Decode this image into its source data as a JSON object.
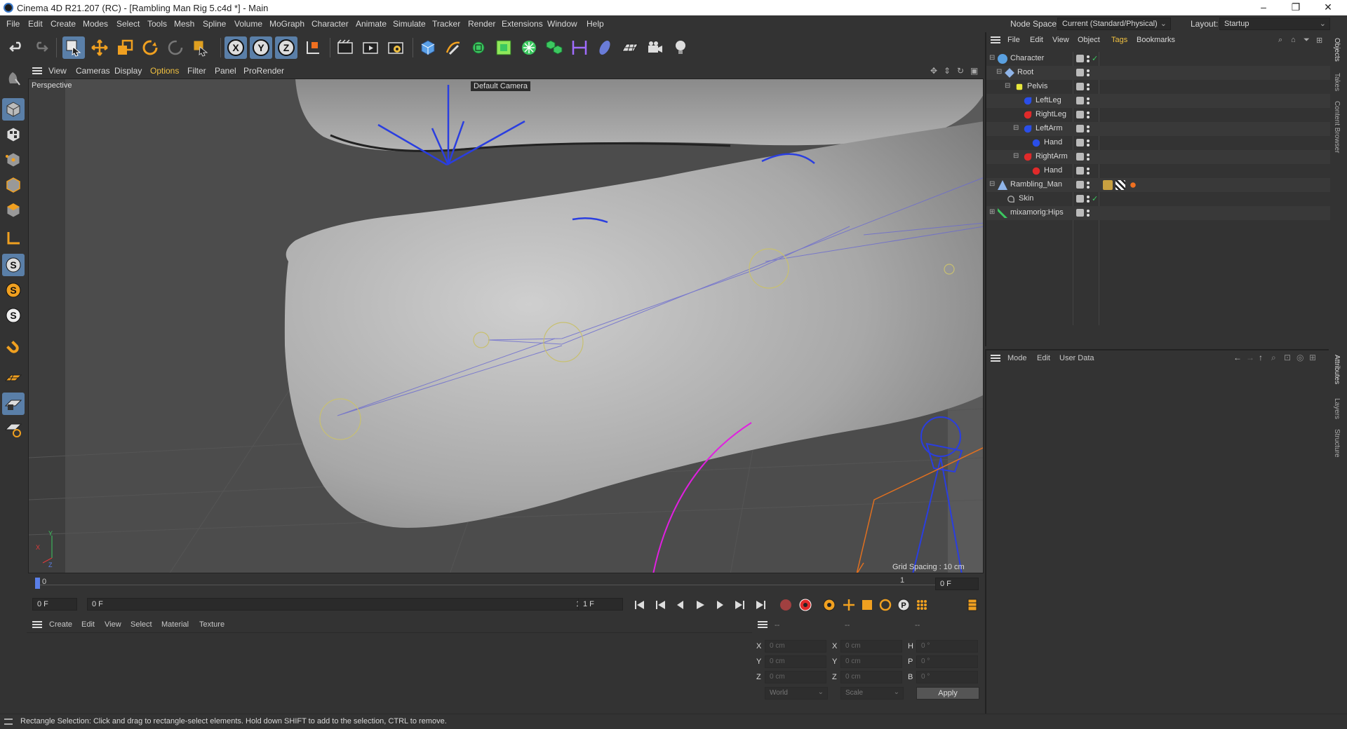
{
  "window": {
    "title": "Cinema 4D R21.207 (RC) - [Rambling Man Rig 5.c4d *] - Main",
    "min": "–",
    "max": "❐",
    "close": "✕"
  },
  "menubar": {
    "items": [
      "File",
      "Edit",
      "Create",
      "Modes",
      "Select",
      "Tools",
      "Mesh",
      "Spline",
      "Volume",
      "MoGraph",
      "Character",
      "Animate",
      "Simulate",
      "Tracker",
      "Render",
      "Extensions",
      "Window",
      "Help"
    ],
    "node_space_label": "Node Space:",
    "node_space_value": "Current (Standard/Physical)",
    "layout_label": "Layout:",
    "layout_value": "Startup"
  },
  "toolbar": {
    "icons": [
      "undo-icon",
      "redo-icon",
      "live-selection-icon",
      "move-icon",
      "scale-icon",
      "rotate-icon",
      "recent-tool-icon",
      "rectangle-selection-icon",
      "x-axis-icon",
      "y-axis-icon",
      "z-axis-icon",
      "coordinate-system-icon",
      "render-view-icon",
      "render-picture-viewer-icon",
      "render-settings-icon",
      "cube-icon",
      "pen-icon",
      "subdivision-icon",
      "extrude-icon",
      "cloner-icon",
      "array-icon",
      "bend-icon",
      "deformer-icon",
      "floor-icon",
      "camera-icon",
      "light-icon"
    ]
  },
  "viewport": {
    "menu": [
      "View",
      "Cameras",
      "Display",
      "Options",
      "Filter",
      "Panel",
      "ProRender"
    ],
    "name": "Perspective",
    "camera": "Default Camera",
    "grid_spacing": "Grid Spacing : 10 cm",
    "axis_x": "X",
    "axis_y": "Y",
    "axis_z": "Z"
  },
  "timeline": {
    "ruler_start": "0",
    "ruler_mark": "1",
    "frame_display": "0 F",
    "start_field": "0 F",
    "range_start": "0 F",
    "range_end": "1 F",
    "end_field": "1 F"
  },
  "materials": {
    "menu": [
      "Create",
      "Edit",
      "View",
      "Select",
      "Material",
      "Texture"
    ]
  },
  "coordinates": {
    "headers": [
      "--",
      "--",
      "--"
    ],
    "rows": [
      {
        "a": "X",
        "av": "0 cm",
        "b": "X",
        "bv": "0 cm",
        "c": "H",
        "cv": "0 °"
      },
      {
        "a": "Y",
        "av": "0 cm",
        "b": "Y",
        "bv": "0 cm",
        "c": "P",
        "cv": "0 °"
      },
      {
        "a": "Z",
        "av": "0 cm",
        "b": "Z",
        "bv": "0 cm",
        "c": "B",
        "cv": "0 °"
      }
    ],
    "space": "World",
    "mode": "Scale",
    "apply": "Apply"
  },
  "objects": {
    "menu": [
      "File",
      "Edit",
      "View",
      "Object",
      "Tags",
      "Bookmarks"
    ],
    "tree": [
      {
        "name": "Character",
        "color": "#5aa0e0",
        "check": true
      },
      {
        "name": "Root",
        "color": "#8fb4e8",
        "check": false
      },
      {
        "name": "Pelvis",
        "color": "#e8e83c",
        "check": false
      },
      {
        "name": "LeftLeg",
        "color": "#2a4ee8",
        "check": false
      },
      {
        "name": "RightLeg",
        "color": "#e02a2a",
        "check": false
      },
      {
        "name": "LeftArm",
        "color": "#2a4ee8",
        "check": false
      },
      {
        "name": "Hand",
        "color": "#2a4ee8",
        "check": false
      },
      {
        "name": "RightArm",
        "color": "#e02a2a",
        "check": false
      },
      {
        "name": "Hand",
        "color": "#e02a2a",
        "check": false
      },
      {
        "name": "Rambling_Man",
        "color": "#8fb4e8",
        "check": false
      },
      {
        "name": "Skin",
        "color": "#aaaaaa",
        "check": true
      },
      {
        "name": "mixamorig:Hips",
        "color": "#3cc860",
        "check": false
      }
    ]
  },
  "attributes": {
    "menu": [
      "Mode",
      "Edit",
      "User Data"
    ]
  },
  "side_tabs": [
    "Objects",
    "Takes",
    "Content Browser",
    "Attributes",
    "Layers",
    "Structure"
  ],
  "status": "Rectangle Selection: Click and drag to rectangle-select elements. Hold down SHIFT to add to the selection, CTRL to remove.",
  "colors": {
    "accent": "#5a7fa8",
    "highlight": "#e8b800",
    "skeleton": "#2a3ee0",
    "magenta": "#e020e0",
    "orange": "#e07020"
  }
}
